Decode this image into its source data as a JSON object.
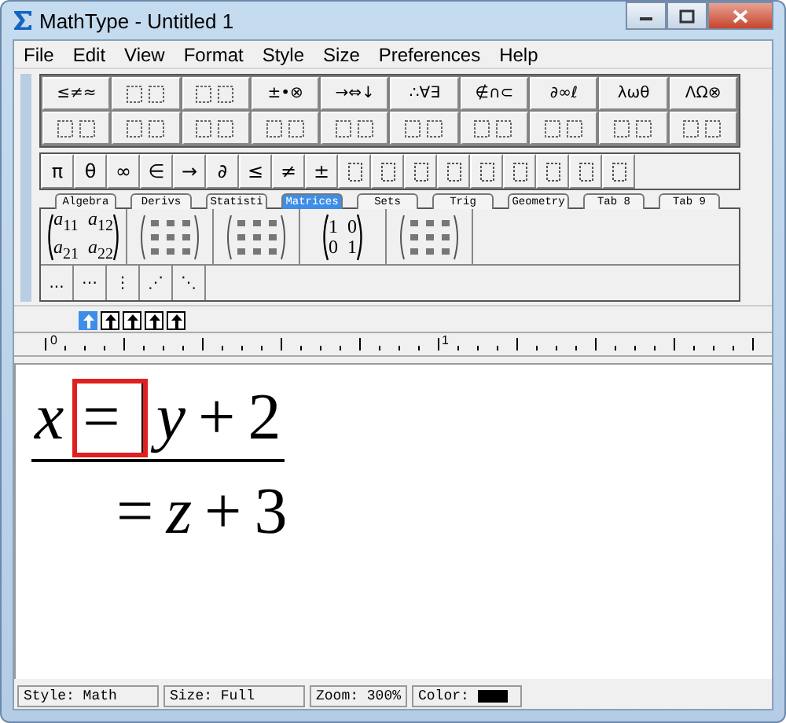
{
  "window": {
    "title": "MathType - Untitled 1"
  },
  "menu": [
    "File",
    "Edit",
    "View",
    "Format",
    "Style",
    "Size",
    "Preferences",
    "Help"
  ],
  "symbol_row": [
    {
      "kind": "text",
      "label": "≤≠≈"
    },
    {
      "kind": "icon"
    },
    {
      "kind": "icon"
    },
    {
      "kind": "text",
      "label": "±•⊗"
    },
    {
      "kind": "text",
      "label": "→⇔↓"
    },
    {
      "kind": "text",
      "label": "∴∀∃"
    },
    {
      "kind": "text",
      "label": "∉∩⊂"
    },
    {
      "kind": "text",
      "label": "∂∞ℓ"
    },
    {
      "kind": "text",
      "label": "λωθ"
    },
    {
      "kind": "text",
      "label": "ΛΩ⊗"
    }
  ],
  "template_row": [
    {
      "kind": "icon"
    },
    {
      "kind": "icon"
    },
    {
      "kind": "icon"
    },
    {
      "kind": "icon"
    },
    {
      "kind": "icon"
    },
    {
      "kind": "icon"
    },
    {
      "kind": "icon"
    },
    {
      "kind": "icon"
    },
    {
      "kind": "icon"
    },
    {
      "kind": "icon"
    }
  ],
  "small_bar": [
    {
      "kind": "text",
      "label": "π"
    },
    {
      "kind": "text",
      "label": "θ"
    },
    {
      "kind": "text",
      "label": "∞"
    },
    {
      "kind": "text",
      "label": "∈"
    },
    {
      "kind": "text",
      "label": "→"
    },
    {
      "kind": "text",
      "label": "∂"
    },
    {
      "kind": "text",
      "label": "≤"
    },
    {
      "kind": "text",
      "label": "≠"
    },
    {
      "kind": "text",
      "label": "±"
    },
    {
      "kind": "icon"
    },
    {
      "kind": "icon"
    },
    {
      "kind": "icon"
    },
    {
      "kind": "icon"
    },
    {
      "kind": "icon"
    },
    {
      "kind": "icon"
    },
    {
      "kind": "icon"
    },
    {
      "kind": "icon"
    },
    {
      "kind": "icon"
    }
  ],
  "tabs": [
    {
      "label": "Algebra",
      "selected": false
    },
    {
      "label": "Derivs",
      "selected": false
    },
    {
      "label": "Statisti",
      "selected": false
    },
    {
      "label": "Matrices",
      "selected": true
    },
    {
      "label": "Sets",
      "selected": false
    },
    {
      "label": "Trig",
      "selected": false
    },
    {
      "label": "Geometry",
      "selected": false
    },
    {
      "label": "Tab 8",
      "selected": false
    },
    {
      "label": "Tab 9",
      "selected": false
    }
  ],
  "matrix_templates": [
    {
      "kind": "cells",
      "cells": [
        [
          "*a*$_{11}$",
          "*a*$_{12}$"
        ],
        [
          "*a*$_{21}$",
          "*a*$_{22}$"
        ]
      ]
    },
    {
      "kind": "icon"
    },
    {
      "kind": "icon"
    },
    {
      "kind": "cells",
      "cells": [
        [
          "1",
          "0"
        ],
        [
          "0",
          "1"
        ]
      ]
    },
    {
      "kind": "icon"
    }
  ],
  "dots_row": [
    {
      "label": "..."
    },
    {
      "label": "⋯"
    },
    {
      "label": "⋮"
    },
    {
      "label": "⋰"
    },
    {
      "label": "⋱"
    }
  ],
  "nudge_buttons": [
    {
      "selected": true
    },
    {
      "selected": false
    },
    {
      "selected": false
    },
    {
      "selected": false
    },
    {
      "selected": false
    }
  ],
  "ruler": {
    "labels": [
      "0",
      "1"
    ]
  },
  "equation": [
    {
      "underlined": true,
      "tokens": [
        {
          "text": "x",
          "italic": true,
          "selected": false
        },
        {
          "text": "=",
          "italic": false,
          "selected": true
        },
        {
          "text": "y",
          "italic": true,
          "selected": false
        },
        {
          "text": "+",
          "italic": false,
          "selected": false
        },
        {
          "text": "2",
          "italic": false,
          "selected": false
        }
      ]
    },
    {
      "underlined": false,
      "tokens": [
        {
          "text": "=",
          "italic": false,
          "selected": false
        },
        {
          "text": "z",
          "italic": true,
          "selected": false
        },
        {
          "text": "+",
          "italic": false,
          "selected": false
        },
        {
          "text": "3",
          "italic": false,
          "selected": false
        }
      ]
    }
  ],
  "status_bar": {
    "style": "Style: Math",
    "size": "Size: Full",
    "zoom": "Zoom: 300%",
    "color_label": "Color:",
    "color": "#000000"
  }
}
